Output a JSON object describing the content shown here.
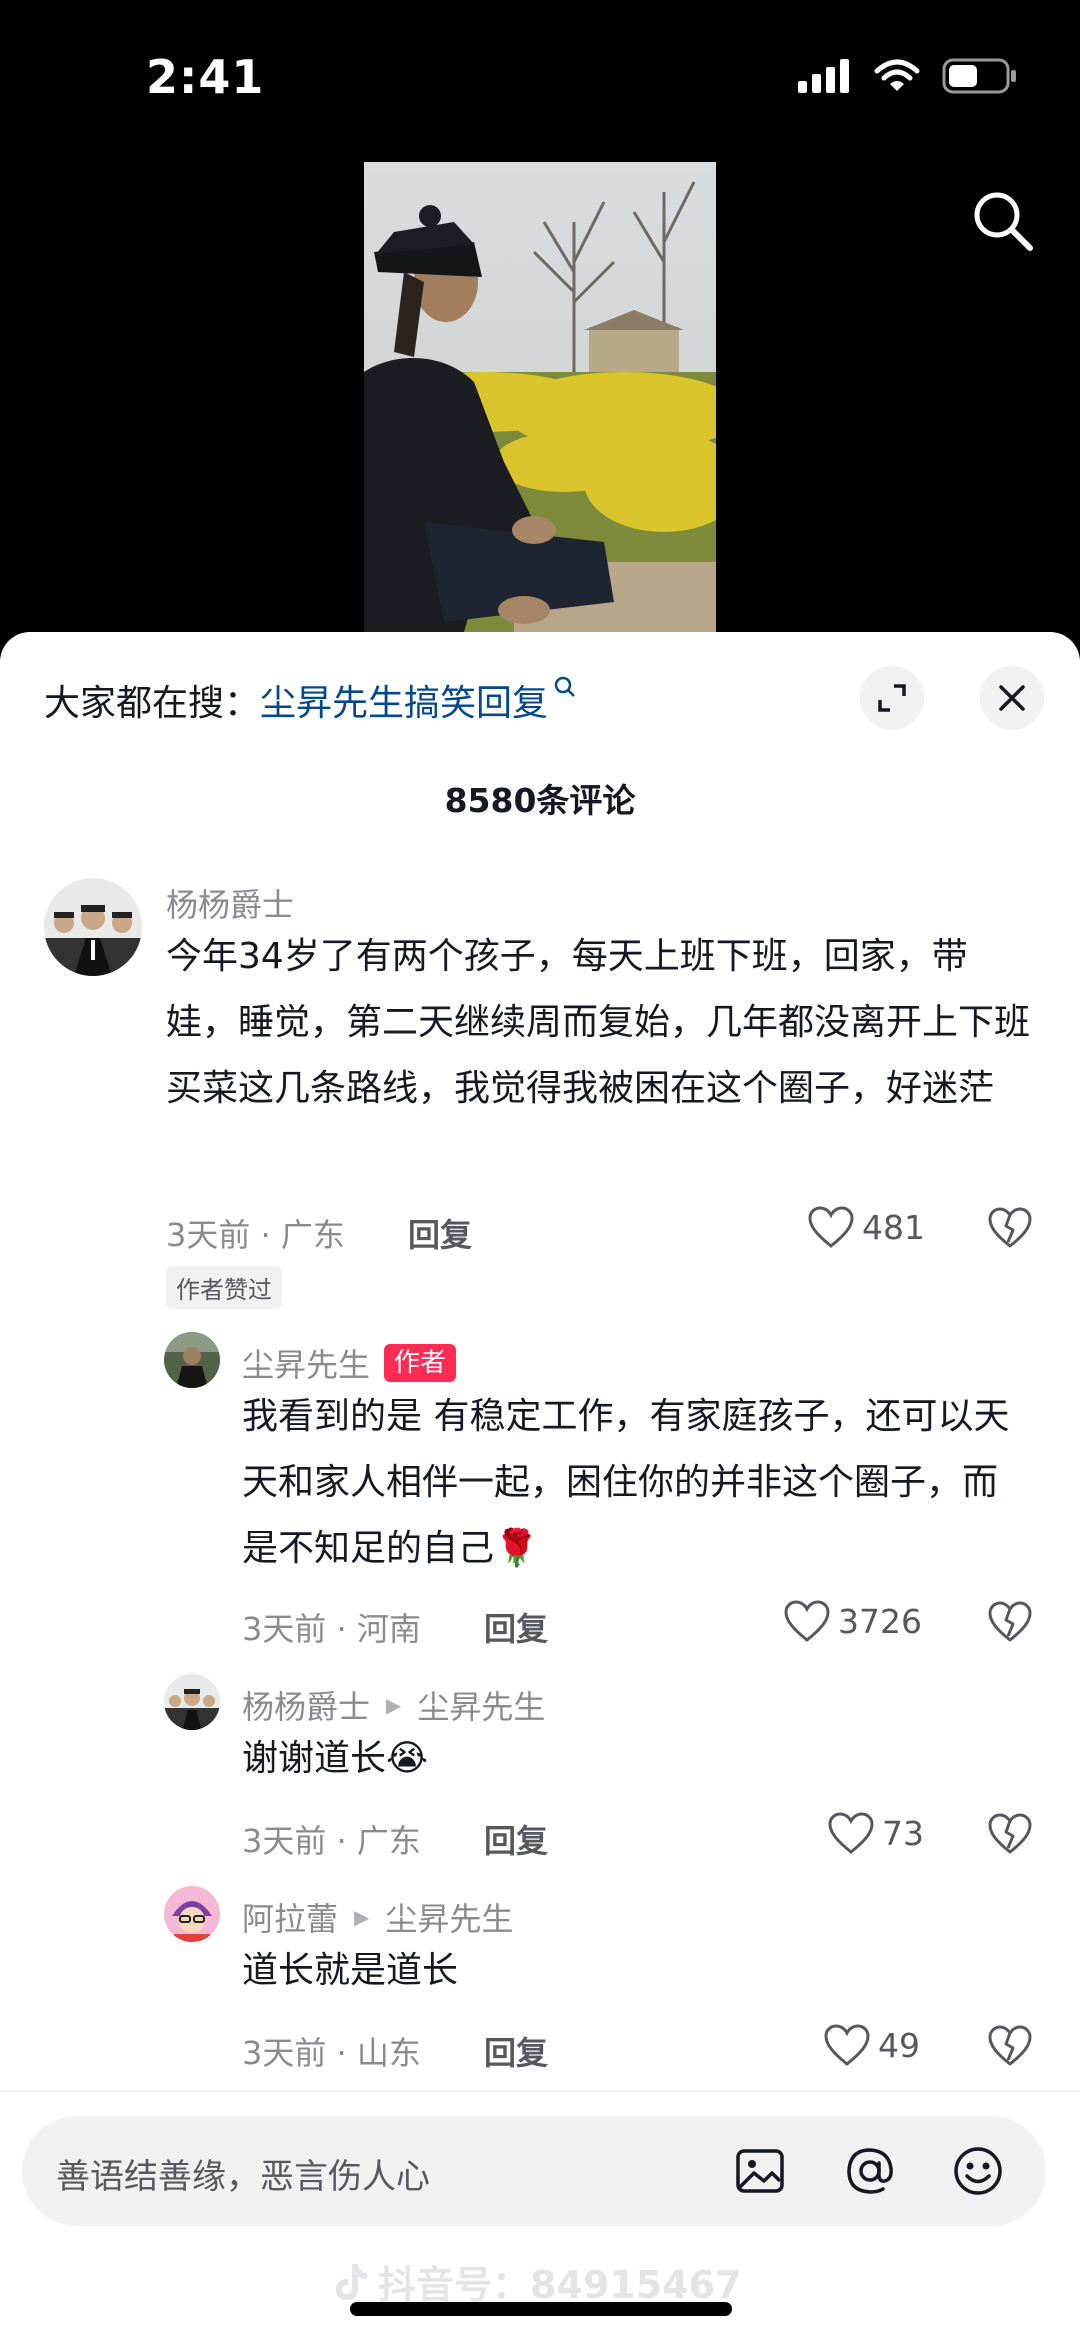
{
  "status": {
    "time": "2:41"
  },
  "hot_search": {
    "prefix": "大家都在搜：",
    "query": "尘昇先生搞笑回复"
  },
  "comment_count": "8580条评论",
  "comments": [
    {
      "user": "杨杨爵士",
      "text": "今年34岁了有两个孩子，每天上班下班，回家，带娃，睡觉，第二天继续周而复始，几年都没离开上下班买菜这几条路线，我觉得我被困在这个圈子，好迷茫",
      "meta": "3天前 · 广东",
      "reply_label": "回复",
      "likes": "481",
      "badge": "作者赞过"
    },
    {
      "user": "尘昇先生",
      "tag": "作者",
      "text": "我看到的是 有稳定工作，有家庭孩子，还可以天天和家人相伴一起，困住你的并非这个圈子，而是不知足的自己🌹",
      "meta": "3天前 · 河南",
      "reply_label": "回复",
      "likes": "3726"
    },
    {
      "user": "杨杨爵士",
      "reply_to": "尘昇先生",
      "text": "谢谢道长😭",
      "meta": "3天前 · 广东",
      "reply_label": "回复",
      "likes": "73"
    },
    {
      "user": "阿拉蕾",
      "reply_to": "尘昇先生",
      "text": "道长就是道长",
      "meta": "3天前 · 山东",
      "reply_label": "回复",
      "likes": "49"
    }
  ],
  "input": {
    "placeholder": "善语结善缘，恶言伤人心"
  },
  "watermark": "抖音号：84915467",
  "icons": [
    "search-icon",
    "expand-icon",
    "close-icon",
    "heart-icon",
    "dislike-icon",
    "image-icon",
    "at-icon",
    "emoji-icon"
  ],
  "colors": {
    "link": "#04498d",
    "author_tag": "#fe2c55",
    "panel": "#ffffff"
  }
}
